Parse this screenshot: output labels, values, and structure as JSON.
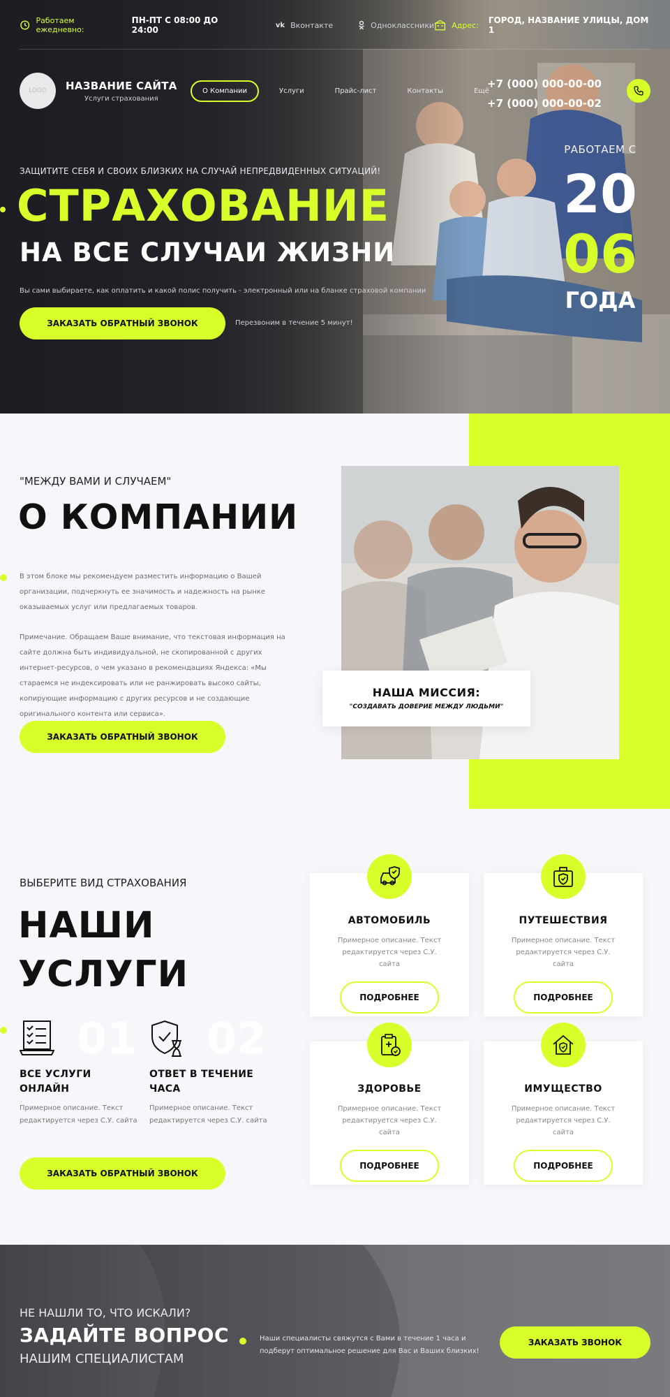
{
  "topbar": {
    "work_label": "Работаем ежедневно:",
    "work_hours": "ПН-ПТ С 08:00 ДО 24:00",
    "social_vk": "Вконтакте",
    "social_ok": "Одноклассники",
    "address_label": "Адрес:",
    "address_value": "ГОРОД, НАЗВАНИЕ УЛИЦЫ, ДОМ 1"
  },
  "header": {
    "logo_text": "LOGO",
    "site_title": "НАЗВАНИЕ САЙТА",
    "site_subtitle": "Услуги страхования",
    "nav": [
      "О Компании",
      "Услуги",
      "Прайс-лист",
      "Контакты",
      "Ещё"
    ],
    "phones": [
      "+7 (000) 000-00-00",
      "+7 (000) 000-00-02"
    ]
  },
  "hero": {
    "kicker": "ЗАЩИТИТЕ СЕБЯ И СВОИХ БЛИЗКИХ НА СЛУЧАЙ НЕПРЕДВИДЕННЫХ СИТУАЦИЙ!",
    "title": "СТРАХОВАНИЕ",
    "subtitle": "НА ВСЕ СЛУЧАИ ЖИЗНИ",
    "description": "Вы сами выбираете, как оплатить и какой полис получить - электронный или на бланке страховой компании",
    "button": "ЗАКАЗАТЬ ОБРАТНЫЙ ЗВОНОК",
    "note": "Перезвоним в течение 5 минут!",
    "since_label": "РАБОТАЕМ С",
    "since_n1": "20",
    "since_n2": "06",
    "since_year": "ГОДА"
  },
  "about": {
    "kicker": "\"МЕЖДУ ВАМИ И СЛУЧАЕМ\"",
    "title": "О КОМПАНИИ",
    "text1": "В этом блоке мы рекомендуем разместить информацию о Вашей организации, подчеркнуть ее значимость и надежность на рынке оказываемых услуг или предлагаемых товаров.",
    "text2": "Примечание. Обращаем Ваше внимание, что текстовая информация на сайте должна быть индивидуальной, не скопированной с других интернет-ресурсов, о чем указано в рекомендациях Яндекса: «Мы стараемся не индексировать или не ранжировать высоко сайты, копирующие информацию с других ресурсов и не создающие оригинального контента или сервиса».",
    "button": "ЗАКАЗАТЬ ОБРАТНЫЙ ЗВОНОК",
    "mission_title": "НАША МИССИЯ:",
    "mission_text": "\"СОЗДАВАТЬ ДОВЕРИЕ МЕЖДУ ЛЮДЬМИ\""
  },
  "services": {
    "kicker": "ВЫБЕРИТЕ ВИД СТРАХОВАНИЯ",
    "title_line1": "НАШИ",
    "title_line2": "УСЛУГИ",
    "features": [
      {
        "num": "01",
        "title": "ВСЕ УСЛУГИ ОНЛАЙН",
        "desc": "Примерное описание. Текст редактируется через С.У. сайта"
      },
      {
        "num": "02",
        "title": "ОТВЕТ В ТЕЧЕНИЕ ЧАСА",
        "desc": "Примерное описание. Текст редактируется через С.У. сайта"
      }
    ],
    "button": "ЗАКАЗАТЬ ОБРАТНЫЙ ЗВОНОК",
    "cards": [
      {
        "title": "АВТОМОБИЛЬ",
        "desc": "Примерное описание. Текст редактируется через С.У. сайта",
        "more": "ПОДРОБНЕЕ",
        "icon": "car-shield-icon"
      },
      {
        "title": "ПУТЕШЕСТВИЯ",
        "desc": "Примерное описание. Текст редактируется через С.У. сайта",
        "more": "ПОДРОБНЕЕ",
        "icon": "suitcase-shield-icon"
      },
      {
        "title": "ЗДОРОВЬЕ",
        "desc": "Примерное описание. Текст редактируется через С.У. сайта",
        "more": "ПОДРОБНЕЕ",
        "icon": "medical-clipboard-icon"
      },
      {
        "title": "ИМУЩЕСТВО",
        "desc": "Примерное описание. Текст редактируется через С.У. сайта",
        "more": "ПОДРОБНЕЕ",
        "icon": "house-shield-icon"
      }
    ]
  },
  "cta": {
    "kicker": "НЕ НАШЛИ ТО, ЧТО ИСКАЛИ?",
    "title": "ЗАДАЙТЕ ВОПРОС",
    "subtitle": "НАШИМ СПЕЦИАЛИСТАМ",
    "description": "Наши специалисты свяжутся с Вами в течение 1 часа и подберут оптимальное решение для Вас и Ваших близких!",
    "button": "ЗАКАЗАТЬ ЗВОНОК"
  },
  "colors": {
    "accent": "#d8ff2a",
    "dark": "#111111",
    "background": "#f7f7fb"
  }
}
